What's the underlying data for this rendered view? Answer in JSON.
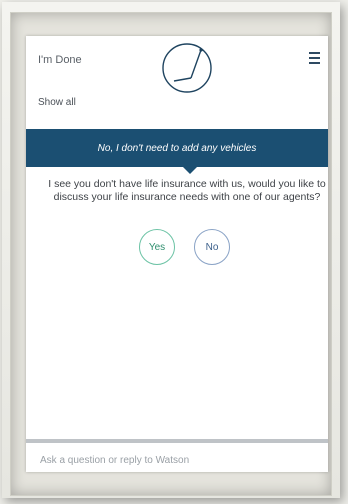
{
  "header": {
    "done_label": "I'm Done",
    "logo_icon": "watson-logo-icon",
    "menu_icon": "hamburger-menu-icon"
  },
  "show_all_label": "Show all",
  "user_reply": "No, I don't need to add any vehicles",
  "bot_question": "I see you don't have life insurance with us, would you like to discuss your life insurance needs with one of our agents?",
  "options": {
    "yes_label": "Yes",
    "no_label": "No"
  },
  "reply_input": {
    "placeholder": "Ask a question or reply to Watson",
    "value": ""
  },
  "colors": {
    "banner": "#1b4f72",
    "yes_border": "#6cc3a5",
    "no_border": "#8aa3c6",
    "logo_stroke": "#1f4460"
  }
}
